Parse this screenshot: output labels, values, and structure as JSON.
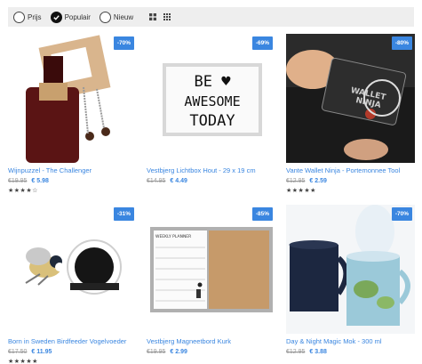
{
  "filters": {
    "options": [
      {
        "label": "Prijs",
        "checked": false
      },
      {
        "label": "Populair",
        "checked": true
      },
      {
        "label": "Nieuw",
        "checked": false
      }
    ],
    "views": [
      "grid-large-icon",
      "grid-small-icon"
    ]
  },
  "products": [
    {
      "title": "Wijnpuzzel - The Challenger",
      "old_price": "€19.95",
      "new_price": "€ 5.98",
      "discount": "-70%",
      "stars": "★★★★☆",
      "rating": 4,
      "image": "wine-puzzle"
    },
    {
      "title": "Vestbjerg Lichtbox Hout - 29 x 19 cm",
      "old_price": "€14.95",
      "new_price": "€ 4.49",
      "discount": "-69%",
      "stars": "",
      "rating": 0,
      "image": "lightbox"
    },
    {
      "title": "Vante Wallet Ninja - Portemonnee Tool",
      "old_price": "€12.95",
      "new_price": "€ 2.59",
      "discount": "-80%",
      "stars": "★★★★★",
      "rating": 5,
      "image": "wallet-ninja"
    },
    {
      "title": "Born in Sweden Birdfeeder Vogelvoeder",
      "old_price": "€17.50",
      "new_price": "€ 11.95",
      "discount": "-31%",
      "stars": "★★★★★",
      "rating": 5,
      "image": "birdfeeder"
    },
    {
      "title": "Vestbjerg Magneetbord Kurk",
      "old_price": "€19.95",
      "new_price": "€ 2.99",
      "discount": "-85%",
      "stars": "",
      "rating": 0,
      "image": "magnet-board"
    },
    {
      "title": "Day & Night Magic Mok - 300 ml",
      "old_price": "€12.95",
      "new_price": "€ 3.88",
      "discount": "-70%",
      "stars": "",
      "rating": 0,
      "image": "magic-mug"
    }
  ],
  "lightbox_text": [
    "BE ♥",
    "AWESOME",
    "TODAY"
  ],
  "wallet_text": [
    "WALLET",
    "NINJA"
  ],
  "planner_text": "WEEKLY PLANNER",
  "colors": {
    "accent": "#3a86e0",
    "filterbar": "#eeeeee"
  }
}
